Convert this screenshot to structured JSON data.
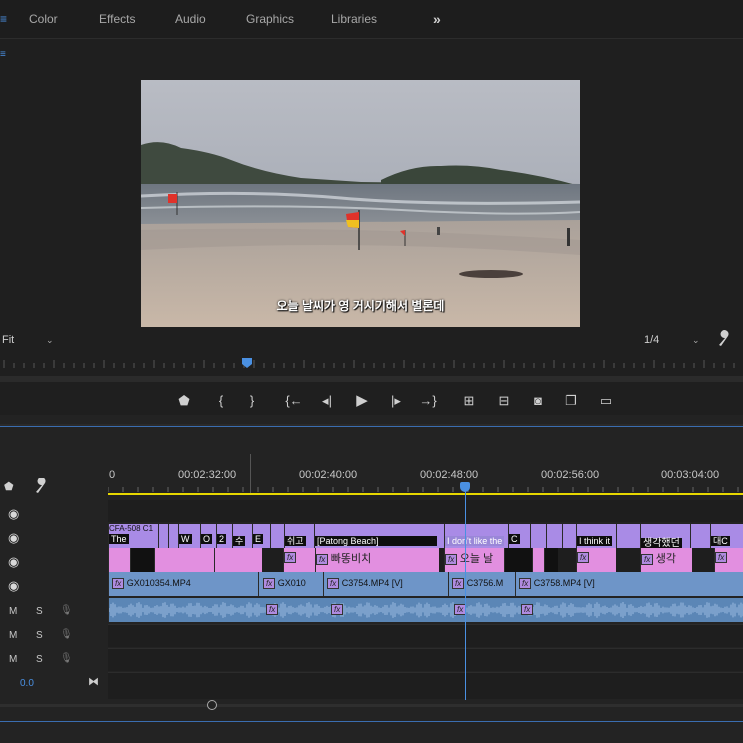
{
  "top_bar": {
    "menu_icon": "hamburger-icon",
    "tabs": [
      "Color",
      "Effects",
      "Audio",
      "Graphics",
      "Libraries"
    ],
    "overflow": "»"
  },
  "monitor": {
    "panel_menu_icon": "panel-menu-icon",
    "subtitle": "오늘 날씨가 영 거시기해서 별론데",
    "zoom_label": "Fit",
    "resolution_label": "1/4",
    "wrench_icon": "wrench-icon"
  },
  "transport": {
    "icons": [
      "marker-icon",
      "mark-in-icon",
      "mark-out-icon",
      "go-to-in-icon",
      "step-back-icon",
      "play-icon",
      "step-forward-icon",
      "go-to-out-icon",
      "lift-icon",
      "extract-icon",
      "export-frame-icon",
      "compare-icon",
      "safe-margins-icon"
    ]
  },
  "timeline": {
    "timecodes": [
      "0",
      "00:02:32:00",
      "00:02:40:00",
      "00:02:48:00",
      "00:02:56:00",
      "00:03:04:00"
    ],
    "track_headers": {
      "marker_icon": "marker-icon",
      "wrench_icon": "wrench-icon",
      "audio_track_labels": [
        "M",
        "S"
      ],
      "volume": "0.0"
    },
    "caption_track": [
      {
        "text": "CFA-508 C1",
        "sub": "The"
      },
      {
        "text": "W"
      },
      {
        "text": "O"
      },
      {
        "text": "2"
      },
      {
        "text": "수"
      },
      {
        "text": "E"
      },
      {
        "text": "쉬고"
      },
      {
        "text": "[Patong Beach]"
      },
      {
        "text": "I don't like the"
      },
      {
        "text": "C"
      },
      {
        "text": "I think it"
      },
      {
        "text": "생각했던"
      },
      {
        "text": "대C"
      }
    ],
    "subtitle_clips": [
      {
        "fx": "fx",
        "label": "빠똥비치"
      },
      {
        "fx": "fx",
        "label": "오늘 날"
      },
      {
        "fx": "fx",
        "label": "생각"
      }
    ],
    "video_clips": [
      {
        "fx": "fx",
        "label": "GX010354.MP4"
      },
      {
        "fx": "fx",
        "label": "GX010"
      },
      {
        "fx": "fx",
        "label": "C3754.MP4 [V]"
      },
      {
        "fx": "fx",
        "label": "C3756.M"
      },
      {
        "fx": "fx",
        "label": "C3758.MP4 [V]"
      }
    ],
    "audio_fx": [
      "fx",
      "fx",
      "fx",
      "fx"
    ]
  }
}
